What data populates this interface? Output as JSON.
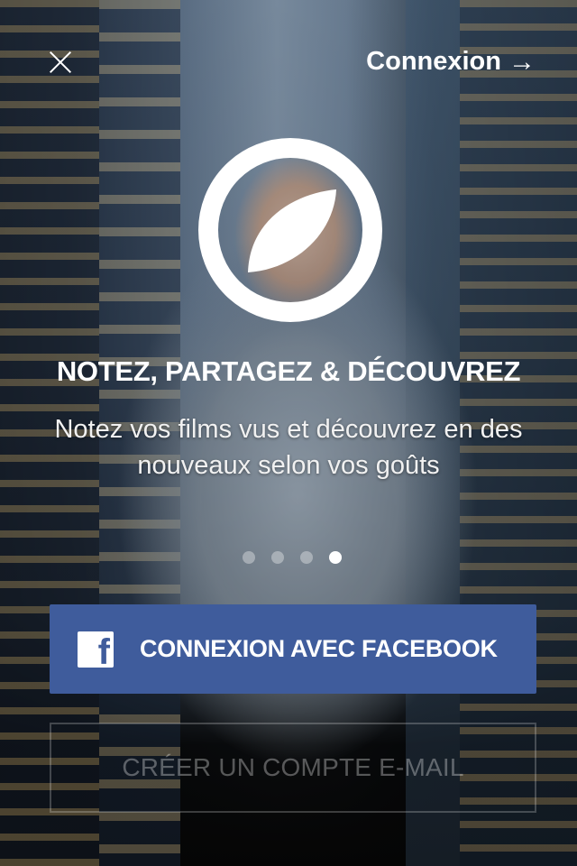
{
  "header": {
    "close_icon": "close-icon",
    "login_label": "Connexion",
    "login_arrow": "→"
  },
  "hero": {
    "logo_icon": "compass-icon",
    "headline": "NOTEZ, PARTAGEZ & DÉCOUVREZ",
    "subtitle": "Notez vos films vus et découvrez en des nouveaux selon vos goûts"
  },
  "pager": {
    "total": 4,
    "active_index": 4
  },
  "actions": {
    "facebook_label": "CONNEXION AVEC FACEBOOK",
    "facebook_icon": "facebook-icon",
    "facebook_icon_glyph": "f",
    "email_label": "CRÉER UN COMPTE E-MAIL"
  },
  "colors": {
    "facebook_blue": "#3f5c9c",
    "text_white": "#ffffff"
  }
}
